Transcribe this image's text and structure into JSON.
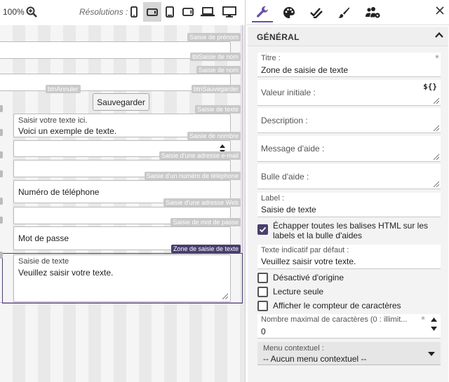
{
  "toolbar": {
    "zoom": "100%",
    "zoom_icon": "zoom-in-icon",
    "resolutions_label": "Résolutions :",
    "devices": [
      "phone-portrait-icon",
      "phone-landscape-icon",
      "tablet-portrait-icon",
      "tablet-landscape-icon",
      "laptop-icon",
      "desktop-icon"
    ],
    "active_device": "phone-landscape-icon"
  },
  "canvas": {
    "tags": {
      "prenom": "Saisie de prénom",
      "lbl_nom": "lblSaisie de nom",
      "nom": "Saisie de nom",
      "annuler": "btnAnnuler",
      "sauvegarder": "btnSauvegarder",
      "texte": "Saisie de texte",
      "nombre": "Saisie de nombre",
      "email": "Saisie d'une adresse e-mail",
      "telephone": "Saisie d'un numéro de téléphone",
      "web": "Saisie d'une adresse Web",
      "mdp": "Saisie de mot de passe",
      "zone": "Zone de saisie de texte"
    },
    "save_button": "Sauvegarder",
    "text_field": {
      "label": "Saisir votre texte ici.",
      "value": "Voici un exemple de texte."
    },
    "phone_field": {
      "value": "Numéro de téléphone"
    },
    "password_field": {
      "value": "Mot de passe"
    },
    "textarea_field": {
      "label": "Saisie de texte",
      "value": "Veuillez saisir votre texte."
    }
  },
  "panel": {
    "tabs": [
      "wrench-icon",
      "palette-icon",
      "double-check-icon",
      "brush-icon",
      "users-cog-icon"
    ],
    "active_tab": "wrench-icon",
    "close_icon": "close-icon",
    "section_title": "GÉNÉRAL",
    "titre": {
      "label": "Titre :",
      "value": "Zone de saisie de texte"
    },
    "valeur_initiale": {
      "placeholder": "Valeur initiale :",
      "badge": "${}"
    },
    "description": {
      "placeholder": "Description :"
    },
    "message_aide": {
      "placeholder": "Message d'aide :"
    },
    "bulle_aide": {
      "placeholder": "Bulle d'aide :"
    },
    "label": {
      "label": "Label :",
      "value": "Saisie de texte"
    },
    "echapper": {
      "text": "Échapper toutes les balises HTML sur les labels et la bulle d'aides",
      "checked": true
    },
    "texte_indicatif": {
      "label": "Texte indicatif par défaut :",
      "value": "Veuillez saisir votre texte."
    },
    "desactive": {
      "text": "Désactivé d'origine",
      "checked": false
    },
    "lecture_seule": {
      "text": "Lecture seule",
      "checked": false
    },
    "compteur": {
      "text": "Afficher le compteur de caractères",
      "checked": false
    },
    "nombre_max": {
      "label": "Nombre maximal de caractères (0 : illimit...",
      "value": "0"
    },
    "menu_contextuel": {
      "label": "Menu contextuel :",
      "value": "-- Aucun menu contextuel --"
    },
    "accent": "#4a3f6e"
  }
}
